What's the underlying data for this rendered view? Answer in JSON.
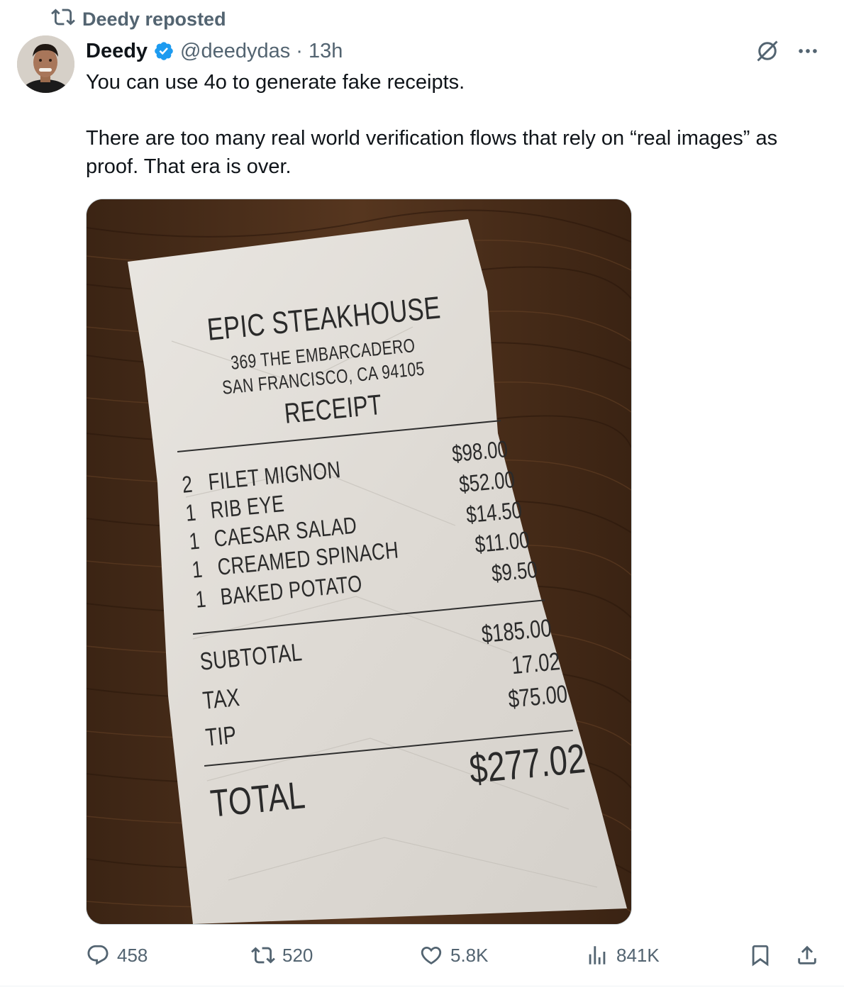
{
  "repost": {
    "label": "Deedy reposted"
  },
  "author": {
    "name": "Deedy",
    "handle": "@deedydas",
    "separator": "·",
    "time": "13h"
  },
  "tweet": {
    "paragraphs": [
      "You can use 4o to generate fake receipts.",
      "There are too many real world verification flows that rely on “real images” as proof. That era is over."
    ]
  },
  "receipt": {
    "restaurant": "EPIC STEAKHOUSE",
    "address_line1": "369 THE EMBARCADERO",
    "address_line2": "SAN FRANCISCO, CA 94105",
    "heading": "RECEIPT",
    "items": [
      {
        "qty": "2",
        "name": "FILET MIGNON",
        "price": "$98.00"
      },
      {
        "qty": "1",
        "name": "RIB EYE",
        "price": "$52.00"
      },
      {
        "qty": "1",
        "name": "CAESAR SALAD",
        "price": "$14.50"
      },
      {
        "qty": "1",
        "name": "CREAMED SPINACH",
        "price": "$11.00"
      },
      {
        "qty": "1",
        "name": "BAKED POTATO",
        "price": "$9.50"
      }
    ],
    "subtotal_label": "SUBTOTAL",
    "subtotal_value": "$185.00",
    "tax_label": "TAX",
    "tax_value": "17.02",
    "tip_label": "TIP",
    "tip_value": "$75.00",
    "total_label": "TOTAL",
    "total_value": "$277.02"
  },
  "actions": {
    "replies": "458",
    "reposts": "520",
    "likes": "5.8K",
    "views": "841K"
  },
  "colors": {
    "text_primary": "#0f1419",
    "text_secondary": "#536471",
    "verified_blue": "#1d9bf0"
  }
}
